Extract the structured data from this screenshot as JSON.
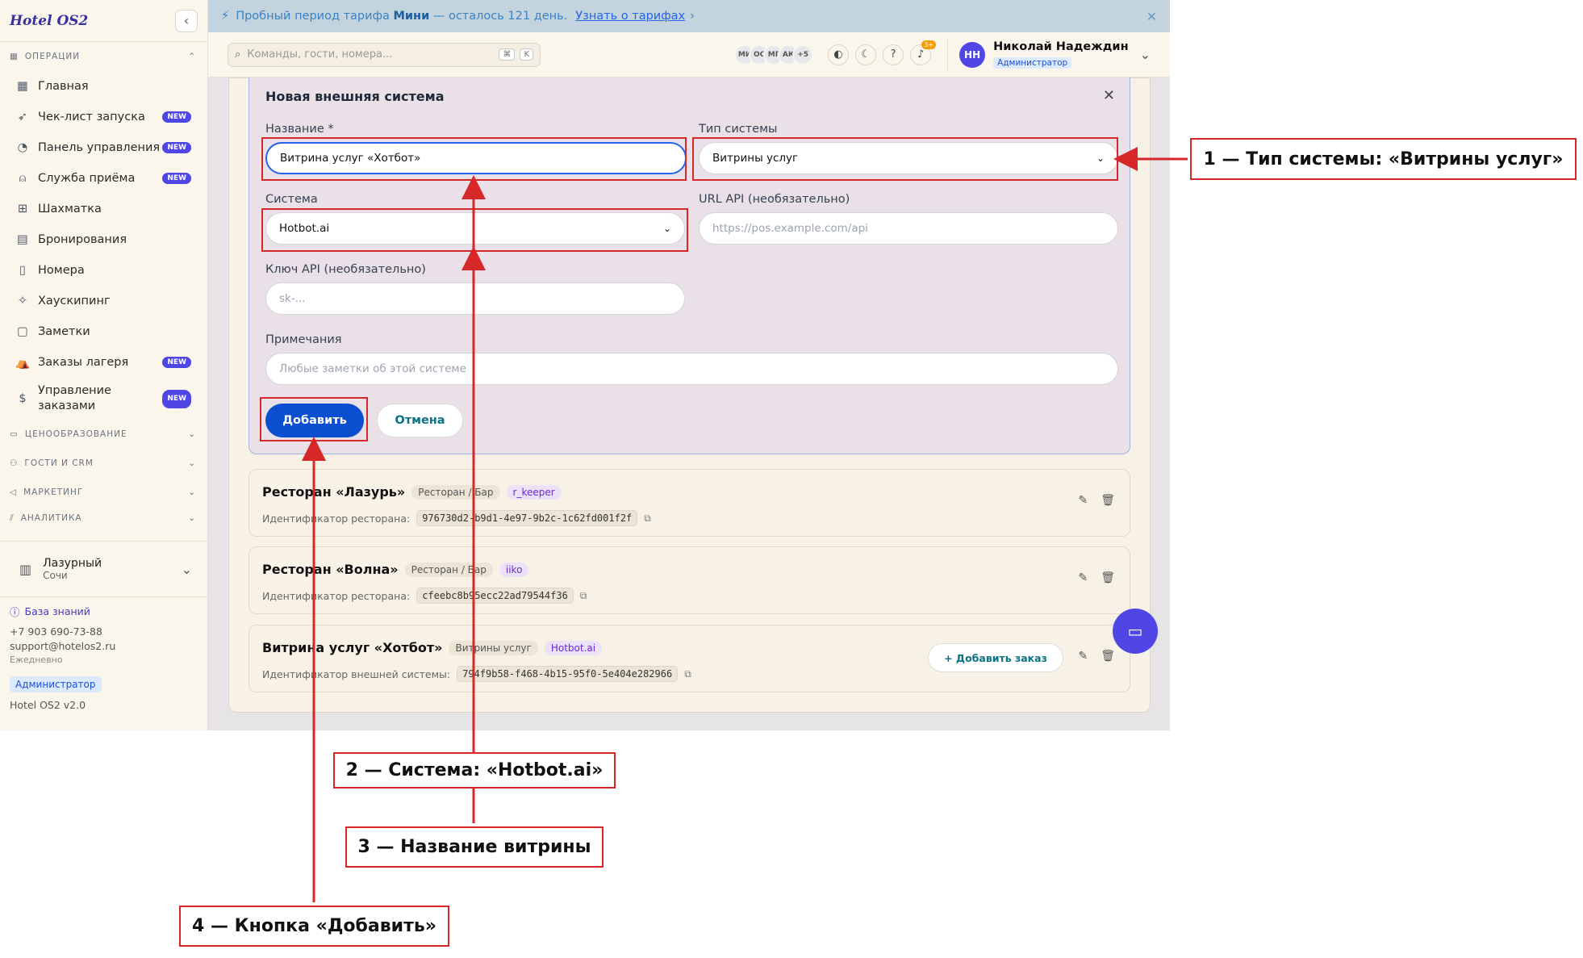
{
  "sidebar": {
    "logo": "Hotel OS2",
    "sections": {
      "operations": "ОПЕРАЦИИ",
      "pricing": "ЦЕНООБРАЗОВАНИЕ",
      "guests": "ГОСТИ И CRM",
      "marketing": "МАРКЕТИНГ",
      "analytics": "АНАЛИТИКА"
    },
    "items": [
      {
        "label": "Главная",
        "icon": "dashboard-grid-icon",
        "new": ""
      },
      {
        "label": "Чек-лист запуска",
        "icon": "rocket-icon",
        "new": "NEW"
      },
      {
        "label": "Панель управления",
        "icon": "gauge-icon",
        "new": "NEW"
      },
      {
        "label": "Служба приёма",
        "icon": "bell-desk-icon",
        "new": "NEW"
      },
      {
        "label": "Шахматка",
        "icon": "grid-icon",
        "new": ""
      },
      {
        "label": "Бронирования",
        "icon": "clipboard-icon",
        "new": ""
      },
      {
        "label": "Номера",
        "icon": "building-icon",
        "new": ""
      },
      {
        "label": "Хаускипинг",
        "icon": "sparkle-icon",
        "new": ""
      },
      {
        "label": "Заметки",
        "icon": "note-icon",
        "new": ""
      },
      {
        "label": "Заказы лагеря",
        "icon": "tent-icon",
        "new": "NEW"
      },
      {
        "label": "Управление заказами",
        "icon": "dollar-doc-icon",
        "new": "NEW"
      }
    ],
    "hotel": {
      "name": "Лазурный",
      "city": "Сочи"
    },
    "footer": {
      "kb": "База знаний",
      "phone": "+7 903 690-73-88",
      "email": "support@hotelos2.ru",
      "hours": "Ежедневно",
      "role": "Администратор",
      "version": "Hotel OS2 v2.0"
    }
  },
  "banner": {
    "prefix": "Пробный период тарифа",
    "plan": "Мини",
    "rest": "— осталось 121 день.",
    "link": "Узнать о тарифах"
  },
  "topbar": {
    "search_placeholder": "Команды, гости, номера...",
    "avatars": [
      "МИ",
      "ОС",
      "МГ",
      "АК",
      "+5"
    ],
    "notif_count": "3+",
    "user_name": "Николай Надеждин",
    "user_initials": "НН",
    "user_role": "Администратор"
  },
  "modal": {
    "title": "Новая внешняя система",
    "name_label": "Название *",
    "name_value": "Витрина услуг «Хотбот»",
    "type_label": "Тип системы",
    "type_value": "Витрины услуг",
    "system_label": "Система",
    "system_value": "Hotbot.ai",
    "url_label": "URL API (необязательно)",
    "url_placeholder": "https://pos.example.com/api",
    "key_label": "Ключ API (необязательно)",
    "key_placeholder": "sk-...",
    "notes_label": "Примечания",
    "notes_placeholder": "Любые заметки об этой системе",
    "add": "Добавить",
    "cancel": "Отмена"
  },
  "cards": [
    {
      "title": "Ресторан «Лазурь»",
      "type": "Ресторан / Бар",
      "provider": "r_keeper",
      "id_label": "Идентификатор ресторана:",
      "id": "976730d2-b9d1-4e97-9b2c-1c62fd001f2f"
    },
    {
      "title": "Ресторан «Волна»",
      "type": "Ресторан / Бар",
      "provider": "iiko",
      "id_label": "Идентификатор ресторана:",
      "id": "cfeebc8b95ecc22ad79544f36"
    },
    {
      "title": "Витрина услуг «Хотбот»",
      "type": "Витрины услуг",
      "provider": "Hotbot.ai",
      "id_label": "Идентификатор внешней системы:",
      "id": "794f9b58-f468-4b15-95f0-5e404e282966",
      "action": "+ Добавить заказ"
    }
  ],
  "annotations": [
    "1 — Тип системы: «Витрины услуг»",
    "2 — Система: «Hotbot.ai»",
    "3 — Название витрины",
    "4 — Кнопка «Добавить»"
  ],
  "colors": {
    "accent": "#4f46e5",
    "annotation": "#d62828",
    "primary_button": "#0b4fd0"
  }
}
